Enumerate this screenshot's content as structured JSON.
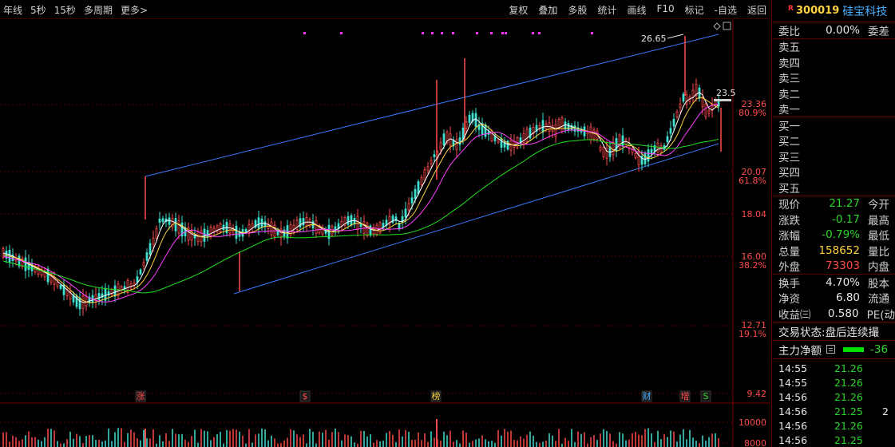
{
  "toolbar": {
    "left": [
      "年线",
      "5秒",
      "15秒",
      "多周期",
      "更多>"
    ],
    "right": [
      "复权",
      "叠加",
      "多股",
      "统计",
      "画线",
      "F10",
      "标记",
      "-自选",
      "返回"
    ]
  },
  "chart": {
    "price_labels": [
      {
        "text": "23.36",
        "color": "#ff4b4b"
      },
      {
        "text": "80.9%",
        "color": "#ff4b4b"
      },
      {
        "text": "20.07",
        "color": "#ff4b4b"
      },
      {
        "text": "61.8%",
        "color": "#ff4b4b"
      },
      {
        "text": "18.04",
        "color": "#ff4b4b"
      },
      {
        "text": "16.00",
        "color": "#ff4b4b"
      },
      {
        "text": "38.2%",
        "color": "#ff4b4b"
      },
      {
        "text": "12.71",
        "color": "#ff4b4b"
      },
      {
        "text": "19.1%",
        "color": "#ff4b4b"
      },
      {
        "text": "9.42",
        "color": "#ff4b4b"
      },
      {
        "text": "10000",
        "color": "#ff4b4b"
      },
      {
        "text": "8000",
        "color": "#ff4b4b"
      }
    ],
    "high_annotation": "26.65",
    "right_mark": "23.5",
    "event_markers": [
      "涨",
      "$",
      "榜",
      "财",
      "增",
      "S"
    ],
    "colors": {
      "up": "#ff4b4b",
      "down": "#40e0d0",
      "ma1": "#ffffff",
      "ma2": "#ffd23f",
      "ma3": "#ff40ff",
      "ma4": "#20e020",
      "channel": "#3a7bff",
      "grid": "#5a0000"
    }
  },
  "panel": {
    "code": "300019",
    "name": "硅宝科技",
    "badge": "R",
    "weibi_label": "委比",
    "weibi_value": "0.00%",
    "weicha_label": "委差",
    "sell_levels": [
      "卖五",
      "卖四",
      "卖三",
      "卖二",
      "卖一"
    ],
    "buy_levels": [
      "买一",
      "买二",
      "买三",
      "买四",
      "买五"
    ],
    "quotes": [
      {
        "label": "现价",
        "value": "21.27",
        "color": "green",
        "label2": "今开"
      },
      {
        "label": "涨跌",
        "value": "-0.17",
        "color": "green",
        "label2": "最高"
      },
      {
        "label": "涨幅",
        "value": "-0.79%",
        "color": "green",
        "label2": "最低"
      },
      {
        "label": "总量",
        "value": "158652",
        "color": "yellow",
        "label2": "量比"
      },
      {
        "label": "外盘",
        "value": "73303",
        "color": "red",
        "label2": "内盘"
      }
    ],
    "stats": [
      {
        "label": "换手",
        "value": "4.70%",
        "label2": "股本"
      },
      {
        "label": "净资",
        "value": "6.80",
        "label2": "流通"
      },
      {
        "label": "收益㈢",
        "value": "0.580",
        "label2": "PE(动"
      }
    ],
    "status_label": "交易状态:",
    "status_value": "盘后连续撮",
    "main_flow_label": "主力净额",
    "main_flow_value": "-36",
    "trades": [
      {
        "time": "14:55",
        "price": "21.26",
        "vol": ""
      },
      {
        "time": "14:55",
        "price": "21.26",
        "vol": ""
      },
      {
        "time": "14:56",
        "price": "21.26",
        "vol": ""
      },
      {
        "time": "14:56",
        "price": "21.25",
        "vol": "2"
      },
      {
        "time": "14:56",
        "price": "21.26",
        "vol": ""
      },
      {
        "time": "14:56",
        "price": "21.25",
        "vol": ""
      }
    ]
  }
}
